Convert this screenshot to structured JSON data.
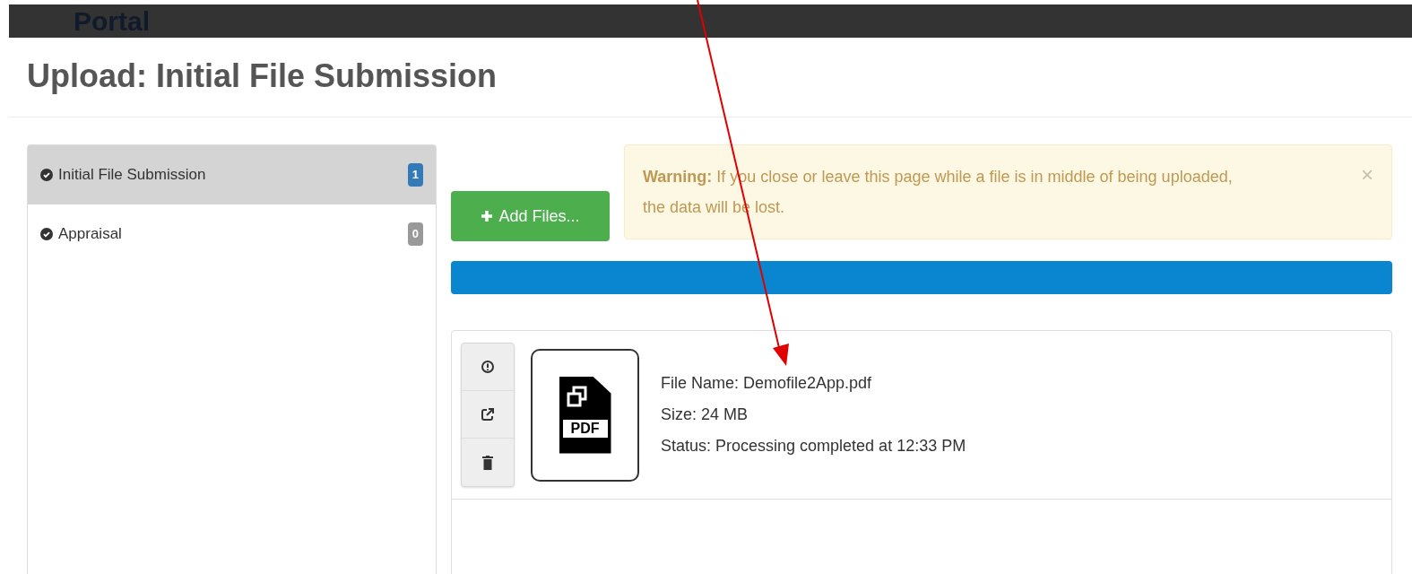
{
  "header": {
    "brand": "Portal"
  },
  "page_title": "Upload: Initial File Submission",
  "sidebar": {
    "items": [
      {
        "label": "Initial File Submission",
        "count": "1",
        "selected": true
      },
      {
        "label": "Appraisal",
        "count": "0",
        "selected": false
      }
    ]
  },
  "add_files_button": "Add Files...",
  "warning": {
    "label": "Warning:",
    "text": "If you close or leave this page while a file is in middle of being uploaded, the data will be lost.",
    "close": "×"
  },
  "progress": {
    "level": 1
  },
  "files": [
    {
      "name": "File Name: Demofile2App.pdf",
      "size": "Size: 24 MB",
      "status": "Status: Processing completed at 12:33 PM",
      "thumb_label": "PDF"
    }
  ]
}
